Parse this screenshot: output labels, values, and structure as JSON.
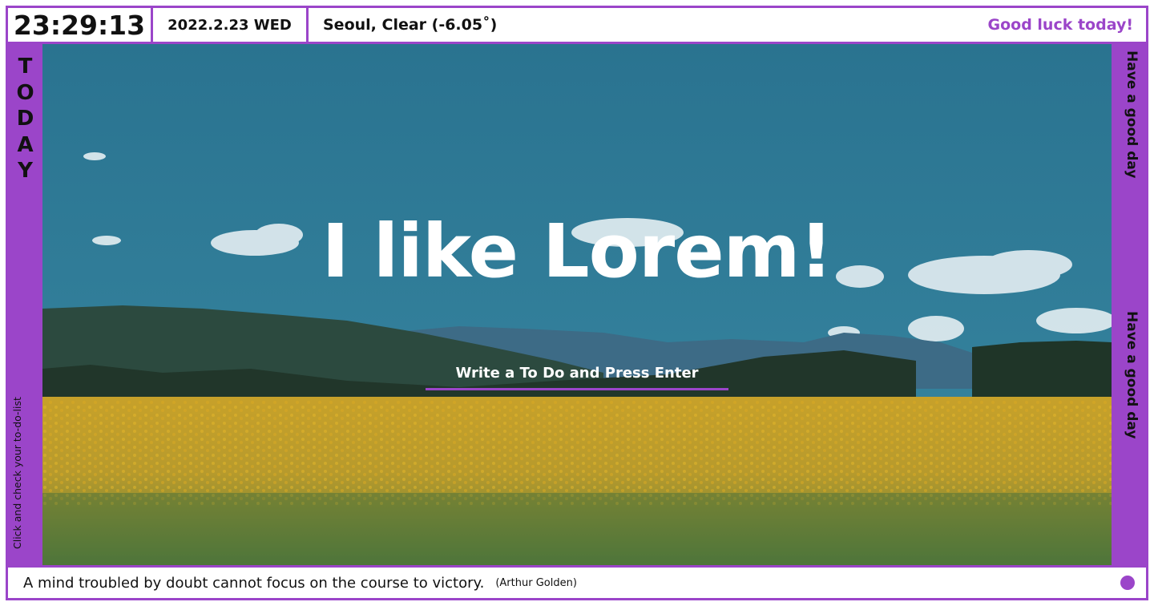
{
  "topbar": {
    "clock": "23:29:13",
    "date": "2022.2.23 WED",
    "weather": "Seoul, Clear (-6.05˚)",
    "greeting": "Good luck today!"
  },
  "sidebar_left": {
    "today_letters": [
      "T",
      "O",
      "D",
      "A",
      "Y"
    ],
    "hint": "Click and check your to-do-list"
  },
  "sidebar_right": {
    "message_top": "Have a good day",
    "message_bottom": "Have a good day"
  },
  "main": {
    "headline": "I like Lorem!",
    "todo_placeholder": "Write a To Do and Press Enter"
  },
  "footer": {
    "quote": "A mind troubled by doubt cannot focus on the course to victory.",
    "author": "(Arthur Golden)"
  },
  "colors": {
    "accent": "#9b45c9",
    "sky": "#2e7b95",
    "field": "#c9a328"
  },
  "icons": {
    "footer_dot": "purple-dot-icon"
  }
}
